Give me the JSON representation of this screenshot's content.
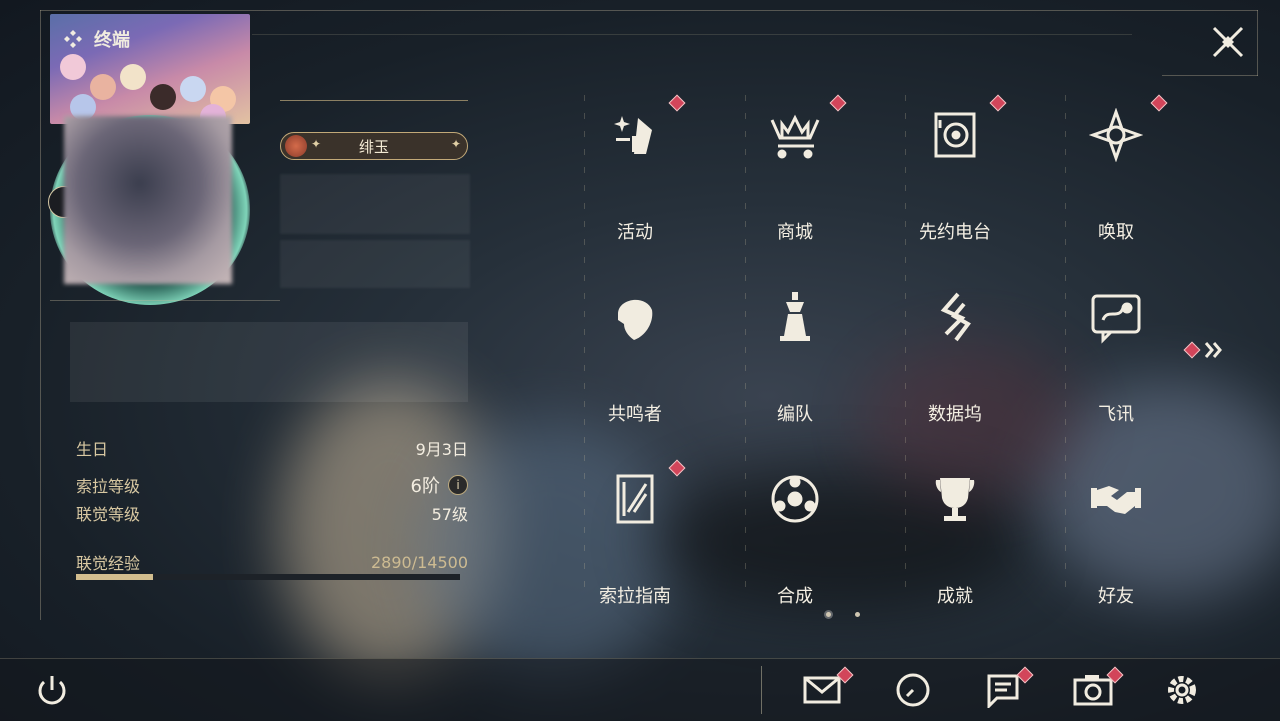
{
  "header": {
    "title": "终端"
  },
  "profile": {
    "name": "绯玉",
    "birthday_label": "生日",
    "birthday_value": "9月3日",
    "sola_level_label": "索拉等级",
    "sola_level_value": "6阶",
    "union_level_label": "联觉等级",
    "union_level_value": "57级",
    "union_exp_label": "联觉经验",
    "union_exp_value": "2890/14500",
    "union_exp_progress": 0.1993
  },
  "menu": {
    "items": [
      {
        "label": "活动",
        "icon": "events-icon",
        "badge": true
      },
      {
        "label": "商城",
        "icon": "shop-crown-icon",
        "badge": true
      },
      {
        "label": "先约电台",
        "icon": "radio-icon",
        "badge": true
      },
      {
        "label": "唤取",
        "icon": "convene-icon",
        "badge": true
      },
      {
        "label": "共鸣者",
        "icon": "resonator-icon",
        "badge": false
      },
      {
        "label": "编队",
        "icon": "team-icon",
        "badge": false
      },
      {
        "label": "数据坞",
        "icon": "data-bank-icon",
        "badge": false
      },
      {
        "label": "飞讯",
        "icon": "chat-icon",
        "badge": false
      },
      {
        "label": "索拉指南",
        "icon": "guidebook-icon",
        "badge": true
      },
      {
        "label": "合成",
        "icon": "synthesis-icon",
        "badge": false
      },
      {
        "label": "成就",
        "icon": "trophy-icon",
        "badge": false
      },
      {
        "label": "好友",
        "icon": "handshake-icon",
        "badge": false
      }
    ],
    "current_page": 1,
    "total_pages": 2
  },
  "bottom_bar": {
    "icons": [
      "power-icon",
      "mail-icon",
      "clock-icon",
      "notice-icon",
      "camera-icon",
      "settings-icon"
    ]
  },
  "colors": {
    "accent_gold": "#d2bd8e",
    "badge_red": "#d2455a",
    "text": "#f4efe3"
  }
}
